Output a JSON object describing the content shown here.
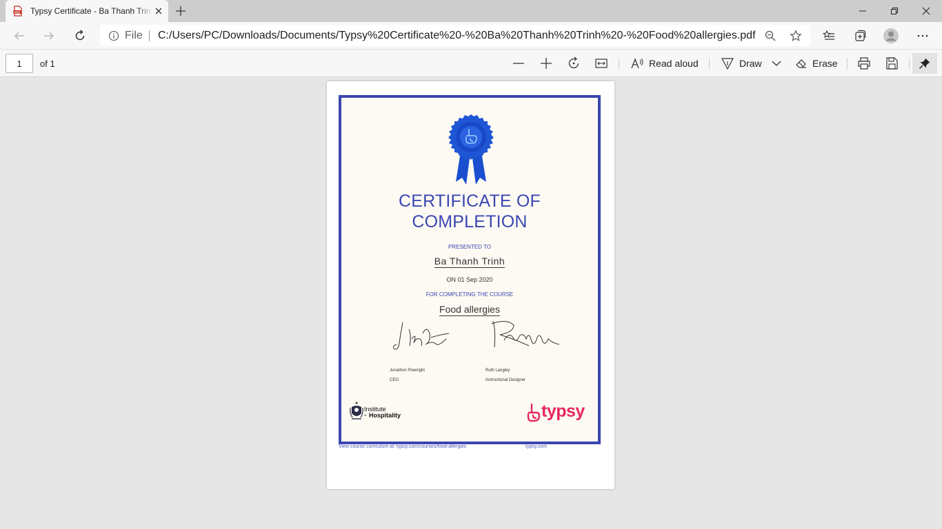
{
  "browser": {
    "tab": {
      "title": "Typsy Certificate - Ba Thanh Trinh - Food allergies.pdf",
      "icon": "pdf-file-icon"
    },
    "address": {
      "scheme_label": "File",
      "url": "C:/Users/PC/Downloads/Documents/Typsy%20Certificate%20-%20Ba%20Thanh%20Trinh%20-%20Food%20allergies.pdf"
    }
  },
  "pdf_toolbar": {
    "page_number": "1",
    "page_of": "of 1",
    "read_aloud_label": "Read aloud",
    "draw_label": "Draw",
    "erase_label": "Erase"
  },
  "certificate": {
    "title_line1": "CERTIFICATE OF",
    "title_line2": "COMPLETION",
    "presented_label": "PRESENTED TO",
    "recipient": "Ba Thanh Trinh",
    "date_line": "ON 01 Sep 2020",
    "course_label": "FOR COMPLETING THE COURSE",
    "course": "Food allergies",
    "signatories": [
      {
        "name": "Jonathon Plowright",
        "role": "CEO"
      },
      {
        "name": "Ruth Langley",
        "role": "Instructional Designer"
      }
    ],
    "institute_logo": {
      "line1": "Institute",
      "of": "of",
      "line2": "Hospitality"
    },
    "brand_logo": "typsy",
    "footer_link": "View course curriculum at: typsy.com/courses/food-allergies",
    "footer_site": "typsy.com"
  },
  "colors": {
    "certificate_blue": "#3c46b0",
    "brand_pink": "#e8265e",
    "chrome_tab_strip": "#cdcdcd",
    "toolbar_bg": "#f7f7f7",
    "viewer_bg": "#e6e6e6"
  }
}
